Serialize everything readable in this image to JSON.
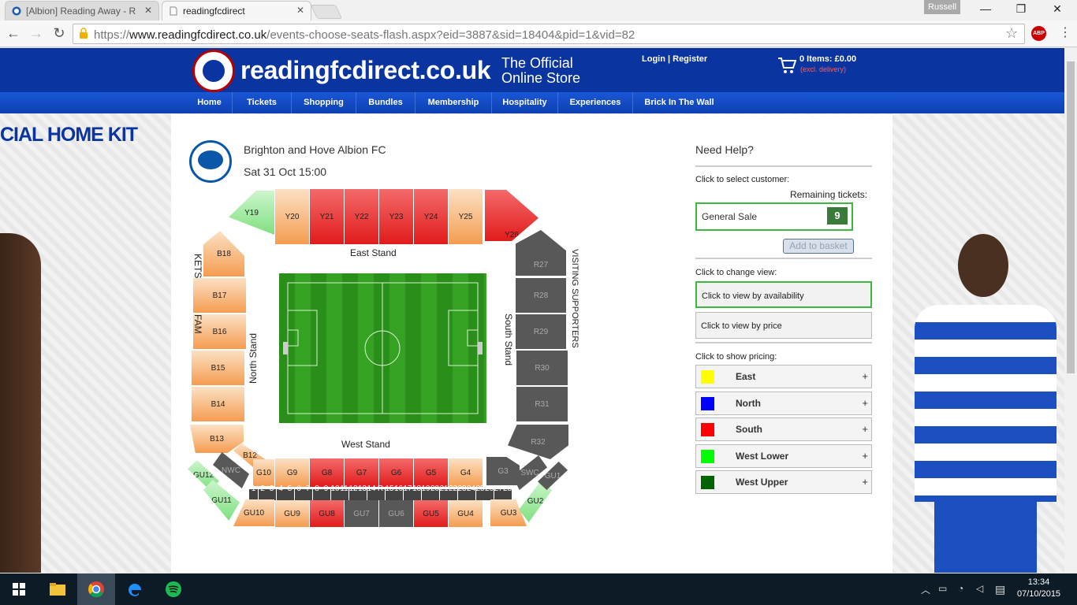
{
  "browser": {
    "tabs": [
      {
        "title": "[Albion] Reading Away - R"
      },
      {
        "title": "readingfcdirect"
      }
    ],
    "user": "Russell",
    "url_prefix": "https://",
    "url_host": "www.readingfcdirect.co.uk",
    "url_rest": "/events-choose-seats-flash.aspx?eid=3887&sid=18404&pid=1&vid=82"
  },
  "site": {
    "name": "readingfcdirect.co.uk",
    "tagline1": "The Official",
    "tagline2": "Online Store",
    "login": "Login | Register",
    "cart_items": "0 Items: £0.00",
    "cart_note": "(excl. delivery)",
    "nav": [
      "Home",
      "Tickets",
      "Shopping",
      "Bundles",
      "Membership",
      "Hospitality",
      "Experiences",
      "Brick In The Wall"
    ],
    "banner": "CIAL HOME KIT"
  },
  "event": {
    "team": "Brighton and Hove Albion FC",
    "date": "Sat 31 Oct 15:00"
  },
  "stadium": {
    "east_stand": "East Stand",
    "west_stand": "West Stand",
    "north_stand": "North Stand",
    "south_stand": "South Stand",
    "visiting": "VISITING SUPPORTERS",
    "family_a": "KETS",
    "family_b": "FAM",
    "east_blocks": [
      "Y19",
      "Y20",
      "Y21",
      "Y22",
      "Y23",
      "Y24",
      "Y25",
      "Y26"
    ],
    "north_blocks": [
      "B18",
      "B17",
      "B16",
      "B15",
      "B14",
      "B13",
      "B12"
    ],
    "south_blocks": [
      "R27",
      "R28",
      "R29",
      "R30",
      "R31",
      "R32"
    ],
    "west_upper": [
      "G10",
      "G9",
      "G8",
      "G7",
      "G6",
      "G5",
      "G4",
      "G3"
    ],
    "west_lower": [
      "GU12",
      "GU11",
      "GU10",
      "GU9",
      "GU8",
      "GU7",
      "GU6",
      "GU5",
      "GU4",
      "GU3",
      "GU2",
      "GU1"
    ],
    "corners": [
      "NWC",
      "SWC"
    ],
    "row_numbers": [
      "1",
      "2",
      "3",
      "4",
      "5",
      "6",
      "7",
      "8",
      "9",
      "10",
      "11",
      "12",
      "13",
      "14",
      "R",
      "15",
      "16",
      "17",
      "18",
      "19",
      "20",
      "21",
      "22",
      "23",
      "24",
      "25",
      "26",
      "27",
      "28"
    ]
  },
  "help": {
    "title": "Need Help?",
    "select_customer": "Click to select customer:",
    "remaining": "Remaining tickets:",
    "general_sale": "General Sale",
    "general_count": "9",
    "add_basket": "Add to basket",
    "change_view": "Click to change view:",
    "view_availability": "Click to view by availability",
    "view_price": "Click to view by price",
    "show_pricing": "Click to show pricing:",
    "pricing": [
      {
        "name": "East",
        "color": "#ffff00"
      },
      {
        "name": "North",
        "color": "#0000ff"
      },
      {
        "name": "South",
        "color": "#ff0000"
      },
      {
        "name": "West Lower",
        "color": "#00ff00"
      },
      {
        "name": "West Upper",
        "color": "#006400"
      }
    ],
    "plus": "+"
  },
  "taskbar": {
    "time": "13:34",
    "date": "07/10/2015"
  }
}
